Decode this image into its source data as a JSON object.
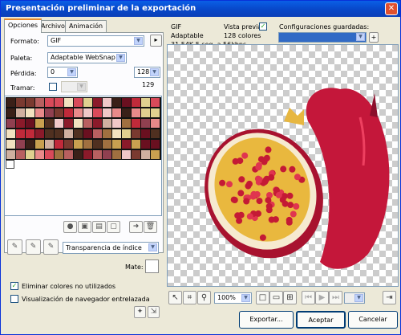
{
  "window": {
    "title": "Presentación preliminar de la exportación",
    "close_glyph": "✕"
  },
  "tabs": [
    "Opciones",
    "Archivo",
    "Animación"
  ],
  "options": {
    "format_label": "Formato:",
    "format_value": "GIF",
    "palette_label": "Paleta:",
    "palette_value": "Adaptable WebSnap",
    "loss_label": "Pérdida:",
    "loss_value": "0",
    "colors_value": "128",
    "colors_count": "129",
    "dither_label": "Tramar:",
    "transparency_value": "Transparencia de índice",
    "matte_label": "Mate:",
    "remove_unused_label": "Eliminar colores no utilizados",
    "remove_unused_checked": true,
    "browser_dither_label": "Visualización de navegador entrelazada",
    "browser_dither_checked": false
  },
  "preview_info": {
    "format": "GIF",
    "palette": "Adaptable",
    "size_time": "31.54K  5 seg. a 56kbps",
    "preview_label": "Vista previa",
    "preview_checked": true,
    "colors": "128 colores"
  },
  "saved_settings": {
    "label": "Configuraciones guardadas:",
    "value": "",
    "add_glyph": "+"
  },
  "toolbar": {
    "zoom_value": "100%"
  },
  "buttons": {
    "export": "Exportar...",
    "ok": "Aceptar",
    "cancel": "Cancelar"
  },
  "colors": {
    "titlebar": "#0a4fd6",
    "tab_accent": "#e68b2c",
    "selection_blue": "#316ac5"
  }
}
